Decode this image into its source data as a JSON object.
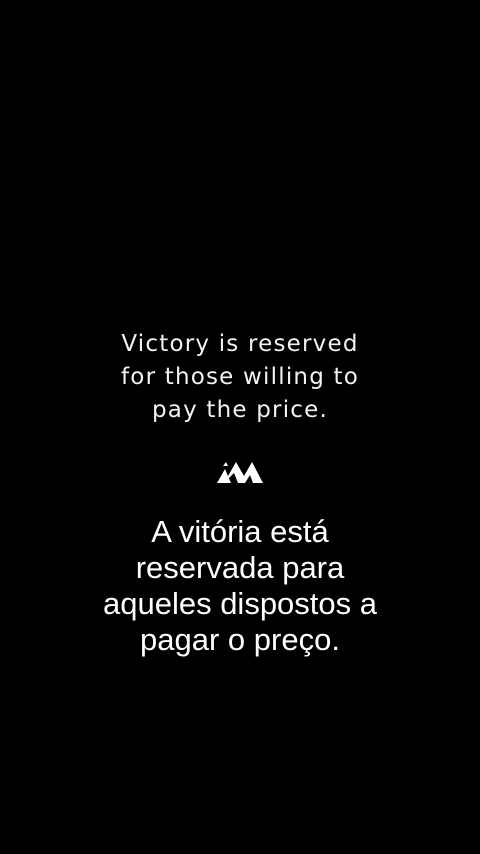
{
  "background_color": "#000000",
  "quote_english": {
    "lines": [
      "Victory is reserved",
      "for those willing to",
      "pay the price."
    ]
  },
  "logo": {
    "icon": "mountain-logo-icon",
    "color": "#ffffff"
  },
  "quote_portuguese": {
    "lines": [
      "A vitória está",
      "reservada para",
      "aqueles dispostos a",
      "pagar o preço."
    ]
  }
}
